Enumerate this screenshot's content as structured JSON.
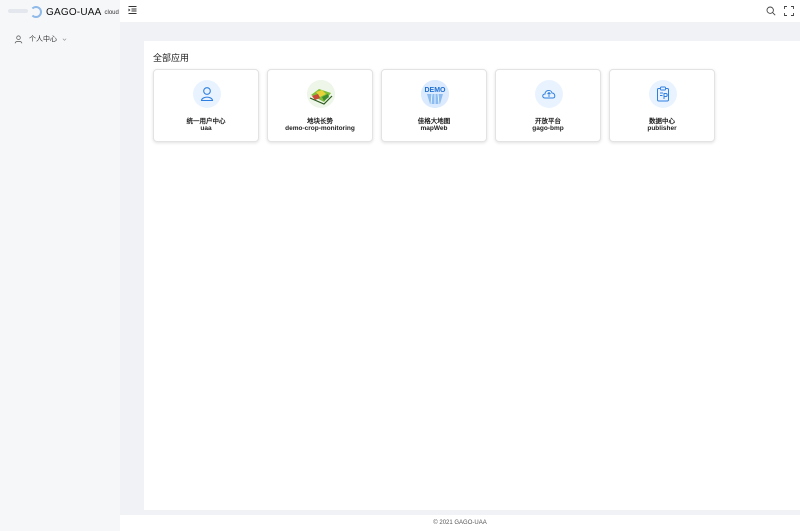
{
  "app": {
    "title": "GAGO-UAA",
    "subtitle": "cloud"
  },
  "sidebar": {
    "items": [
      {
        "label": "个人中心",
        "icon": "user-icon"
      }
    ]
  },
  "header": {
    "actions": [
      "search-icon",
      "fullscreen-icon"
    ]
  },
  "main": {
    "title": "全部应用",
    "apps": [
      {
        "name": "统一用户中心",
        "code": "uaa",
        "icon": "user-icon"
      },
      {
        "name": "地块长势",
        "code": "demo-crop-monitoring",
        "icon": "crop-map-icon"
      },
      {
        "name": "佳格大地图",
        "code": "mapWeb",
        "icon": "demo-globe-icon",
        "icon_text": "DEMO"
      },
      {
        "name": "开放平台",
        "code": "gago-bmp",
        "icon": "cloud-icon"
      },
      {
        "name": "数据中心",
        "code": "publisher",
        "icon": "clipboard-icon"
      }
    ]
  },
  "footer": {
    "text": "© 2021 GAGO-UAA"
  },
  "colors": {
    "accent": "#1890ff",
    "icon_bg": "#e9f3ff",
    "page_bg": "#f0f2f5"
  }
}
